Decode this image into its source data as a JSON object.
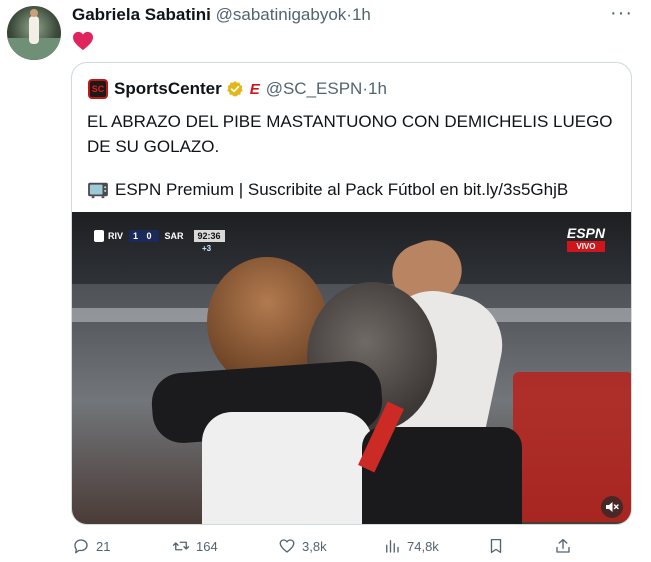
{
  "tweet": {
    "author_name": "Gabriela Sabatini",
    "author_handle": "@sabatinigabyok",
    "separator": "·",
    "time": "1h",
    "more_label": "···",
    "text_emoji": "heart"
  },
  "quoted": {
    "logo_text": "SC",
    "author_name": "SportsCenter",
    "badge_text": "E",
    "author_handle": "@SC_ESPN",
    "separator": "·",
    "time": "1h",
    "text": "EL ABRAZO DEL PIBE MASTANTUONO CON DEMICHELIS LUEGO DE SU GOLAZO.",
    "link_text": "ESPN Premium | Suscribite al Pack Fútbol en bit.ly/3s5GhjB",
    "video": {
      "scorebug": {
        "home": "RIV",
        "away": "SAR",
        "score": "1 0",
        "clock": "92:36",
        "added": "+3"
      },
      "espn_wordmark": "ESPN",
      "live_label": "VIVO"
    }
  },
  "actions": {
    "replies": "21",
    "retweets": "164",
    "likes": "3,8k",
    "views": "74,8k"
  },
  "colors": {
    "text": "#0f1419",
    "muted": "#536471",
    "border": "#cfd9de",
    "heart": "#e0245e",
    "espn_red": "#d0161b",
    "verified_gold": "#e2b719"
  }
}
